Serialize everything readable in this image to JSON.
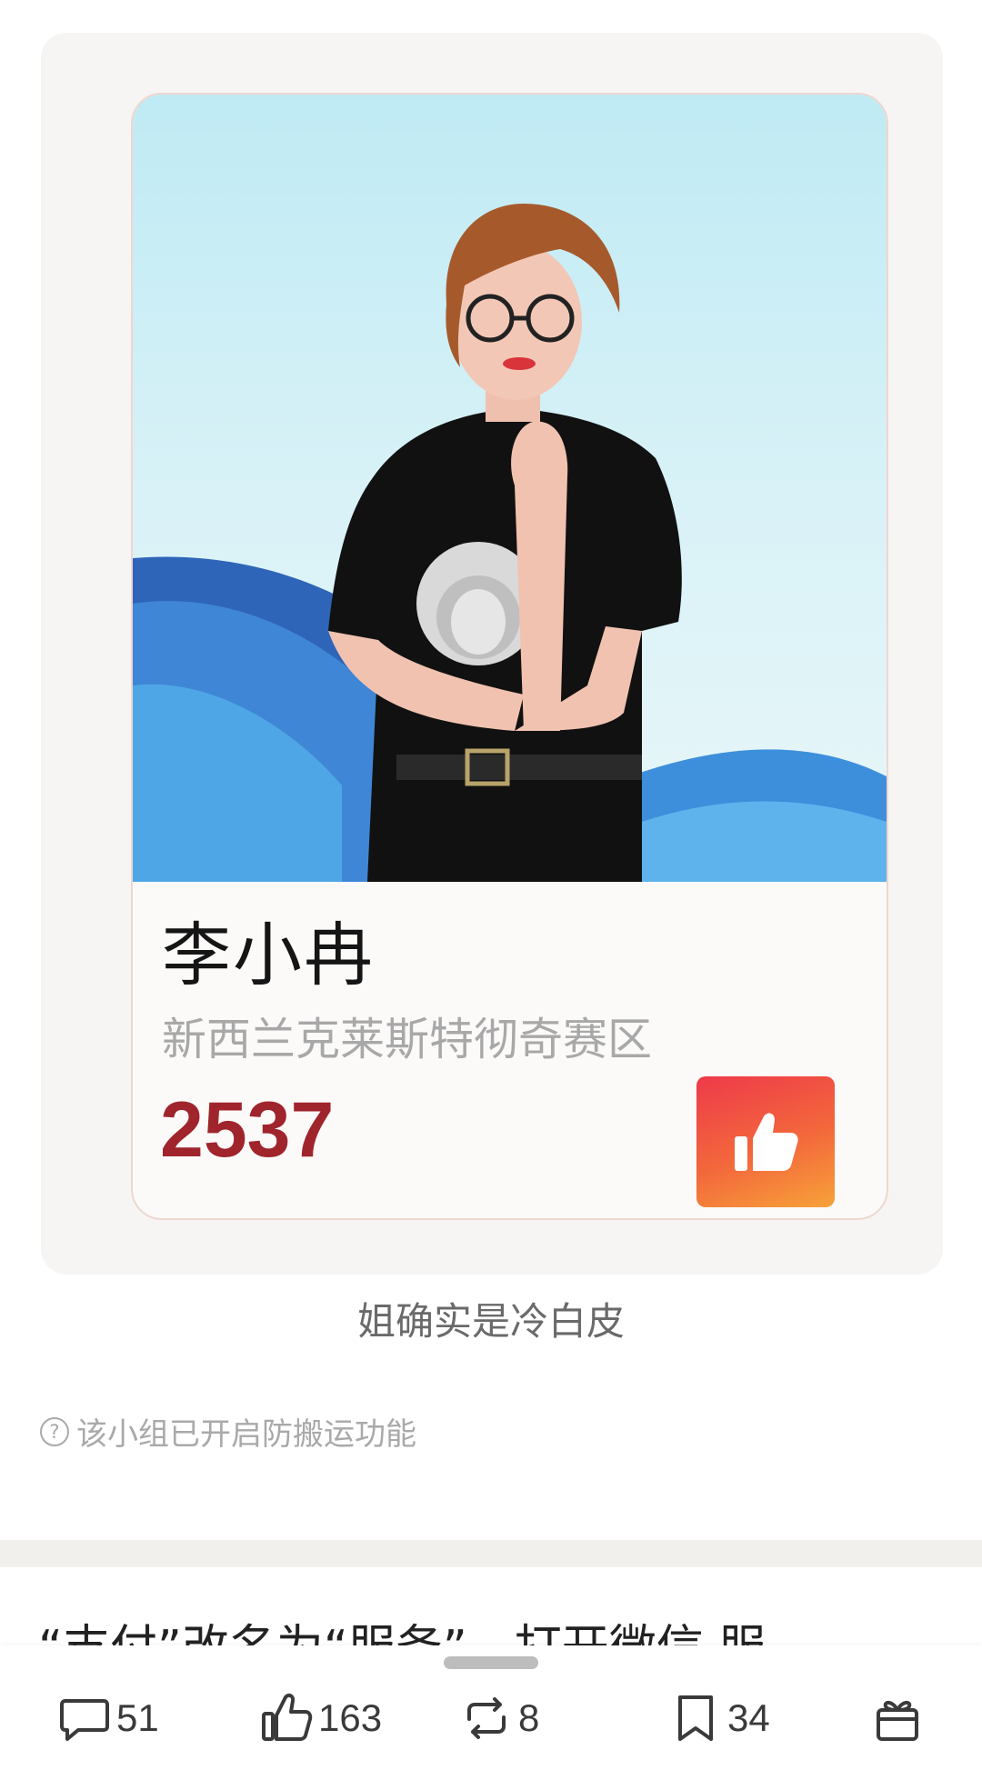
{
  "card": {
    "name": "李小冉",
    "region": "新西兰克莱斯特彻奇赛区",
    "votes": "2537",
    "vote_button_icon": "thumbs-up-icon",
    "accent_color": "#a0242c"
  },
  "caption": "姐确实是冷白皮",
  "notice": {
    "icon": "question-circle-icon",
    "text": "该小组已开启防搬运功能"
  },
  "next_post_title": "“支付”改名为“服务”，打开微信 服",
  "actions": {
    "comments": "51",
    "likes": "163",
    "reposts": "8",
    "favorites": "34",
    "gift_icon": "gift-icon"
  }
}
